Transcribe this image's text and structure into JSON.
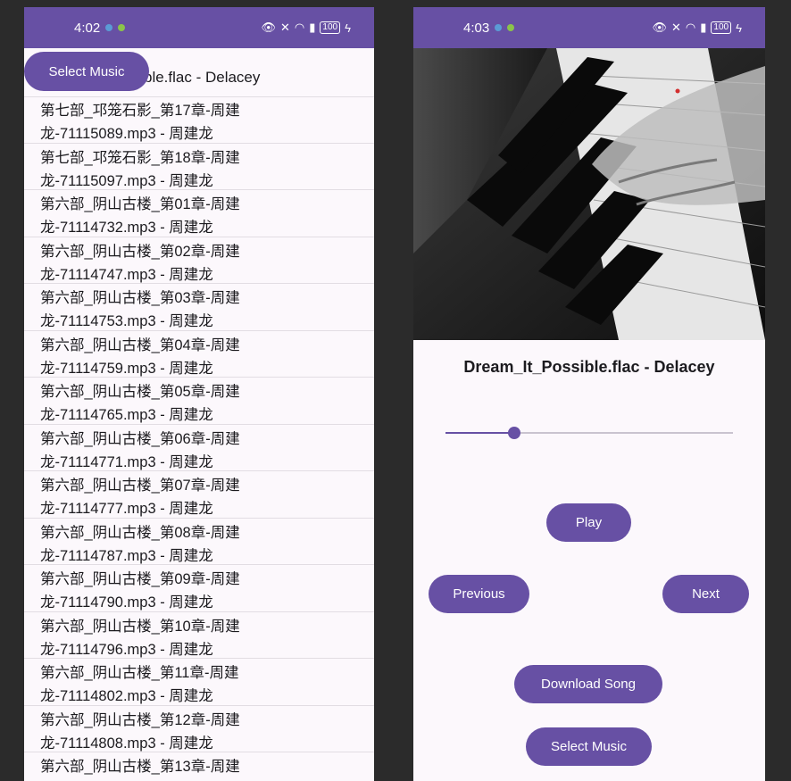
{
  "left_screen": {
    "status": {
      "time": "4:02",
      "battery": "100"
    },
    "select_button": "Select Music",
    "now_playing_partial": "ble.flac - Delacey",
    "songs": [
      {
        "line1": "第七部_邛笼石影_第17章-周建",
        "line2": "龙-71115089.mp3 - 周建龙"
      },
      {
        "line1": "第七部_邛笼石影_第18章-周建",
        "line2": "龙-71115097.mp3 - 周建龙"
      },
      {
        "line1": "第六部_阴山古楼_第01章-周建",
        "line2": "龙-71114732.mp3 - 周建龙"
      },
      {
        "line1": "第六部_阴山古楼_第02章-周建",
        "line2": "龙-71114747.mp3 - 周建龙"
      },
      {
        "line1": "第六部_阴山古楼_第03章-周建",
        "line2": "龙-71114753.mp3 - 周建龙"
      },
      {
        "line1": "第六部_阴山古楼_第04章-周建",
        "line2": "龙-71114759.mp3 - 周建龙"
      },
      {
        "line1": "第六部_阴山古楼_第05章-周建",
        "line2": "龙-71114765.mp3 - 周建龙"
      },
      {
        "line1": "第六部_阴山古楼_第06章-周建",
        "line2": "龙-71114771.mp3 - 周建龙"
      },
      {
        "line1": "第六部_阴山古楼_第07章-周建",
        "line2": "龙-71114777.mp3 - 周建龙"
      },
      {
        "line1": "第六部_阴山古楼_第08章-周建",
        "line2": "龙-71114787.mp3 - 周建龙"
      },
      {
        "line1": "第六部_阴山古楼_第09章-周建",
        "line2": "龙-71114790.mp3 - 周建龙"
      },
      {
        "line1": "第六部_阴山古楼_第10章-周建",
        "line2": "龙-71114796.mp3 - 周建龙"
      },
      {
        "line1": "第六部_阴山古楼_第11章-周建",
        "line2": "龙-71114802.mp3 - 周建龙"
      },
      {
        "line1": "第六部_阴山古楼_第12章-周建",
        "line2": "龙-71114808.mp3 - 周建龙"
      },
      {
        "line1": "第六部_阴山古楼_第13章-周建",
        "line2": ""
      }
    ]
  },
  "right_screen": {
    "status": {
      "time": "4:03",
      "battery": "100"
    },
    "song_title": "Dream_It_Possible.flac - Delacey",
    "progress_fraction": 0.24,
    "buttons": {
      "play": "Play",
      "previous": "Previous",
      "next": "Next",
      "download": "Download Song",
      "select": "Select Music"
    }
  },
  "colors": {
    "accent": "#6750a4",
    "surface": "#fcf8fc",
    "divider": "#e2dde3"
  }
}
